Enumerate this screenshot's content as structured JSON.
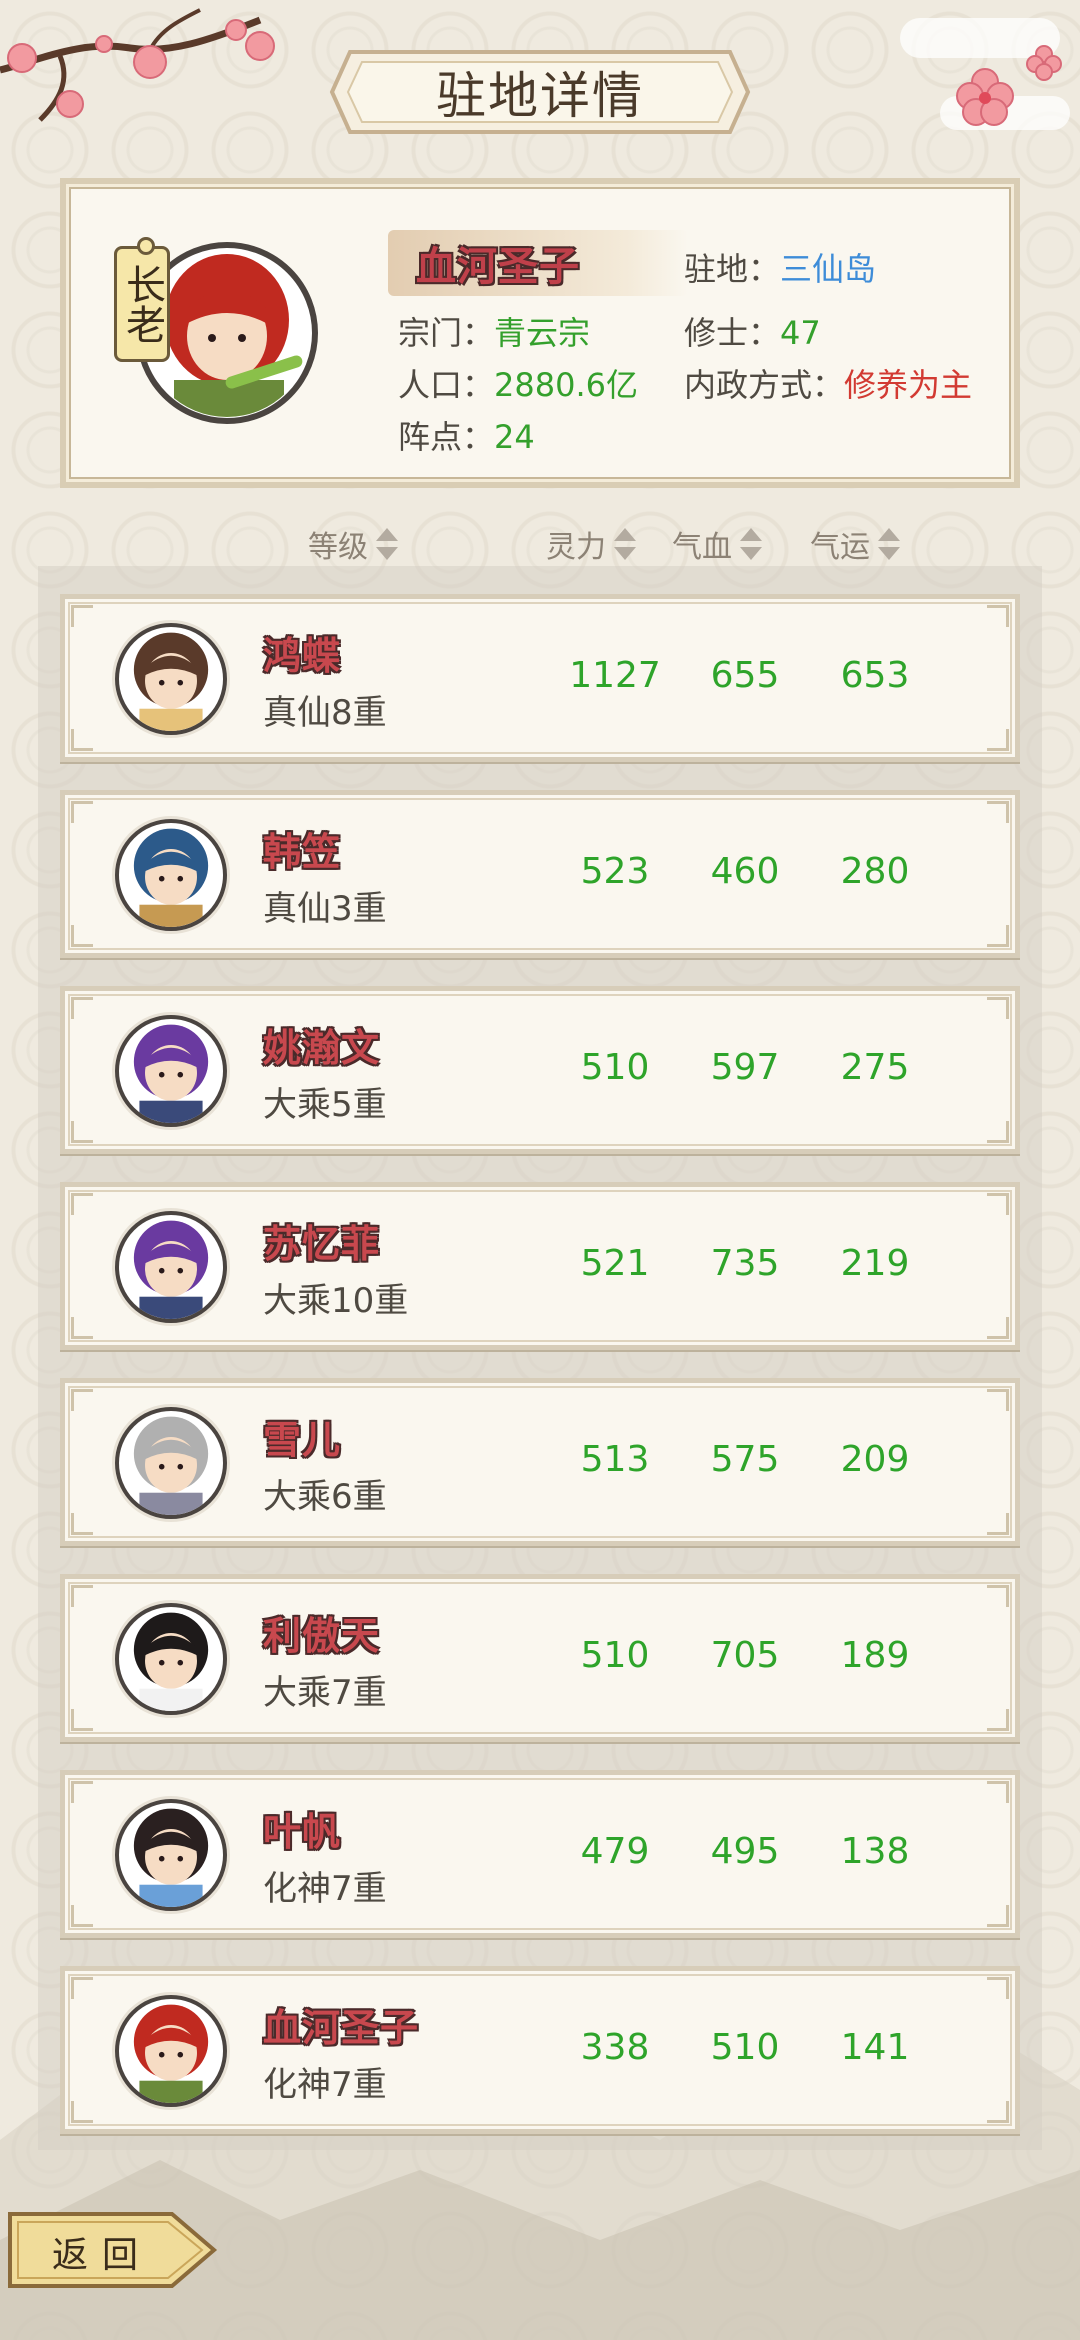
{
  "title": "驻地详情",
  "station": {
    "elder_tag": "长老",
    "name": "血河圣子",
    "location_label": "驻地：",
    "location_value": "三仙岛",
    "sect_label": "宗门：",
    "sect_value": "青云宗",
    "cultivators_label": "修士：",
    "cultivators_value": "47",
    "population_label": "人口：",
    "population_value": "2880.6亿",
    "policy_label": "内政方式：",
    "policy_value": "修养为主",
    "formation_label": "阵点：",
    "formation_value": "24"
  },
  "columns": {
    "rank": "等级",
    "spirit": "灵力",
    "blood": "气血",
    "luck": "气运"
  },
  "disciples": [
    {
      "name": "鸿蝶",
      "rank": "真仙8重",
      "spirit": "1127",
      "blood": "655",
      "luck": "653",
      "hair": "#5a3a2a",
      "robe": "#e6c27a"
    },
    {
      "name": "韩笠",
      "rank": "真仙3重",
      "spirit": "523",
      "blood": "460",
      "luck": "280",
      "hair": "#2c5a8a",
      "robe": "#c69a52"
    },
    {
      "name": "姚瀚文",
      "rank": "大乘5重",
      "spirit": "510",
      "blood": "597",
      "luck": "275",
      "hair": "#6a3aa0",
      "robe": "#3a4a7a"
    },
    {
      "name": "苏忆菲",
      "rank": "大乘10重",
      "spirit": "521",
      "blood": "735",
      "luck": "219",
      "hair": "#6a3aa0",
      "robe": "#3a4a7a"
    },
    {
      "name": "雪儿",
      "rank": "大乘6重",
      "spirit": "513",
      "blood": "575",
      "luck": "209",
      "hair": "#b0b0b0",
      "robe": "#8a8aa0"
    },
    {
      "name": "利傲天",
      "rank": "大乘7重",
      "spirit": "510",
      "blood": "705",
      "luck": "189",
      "hair": "#1e1a1a",
      "robe": "#f2f2f2"
    },
    {
      "name": "叶帆",
      "rank": "化神7重",
      "spirit": "479",
      "blood": "495",
      "luck": "138",
      "hair": "#2a2020",
      "robe": "#6aa0d8"
    },
    {
      "name": "血河圣子",
      "rank": "化神7重",
      "spirit": "338",
      "blood": "510",
      "luck": "141",
      "hair": "#c02a20",
      "robe": "#6a8a3a"
    }
  ],
  "back_button": "返回",
  "colors": {
    "name_red": "#c8484e",
    "stat_green": "#2ea42a",
    "location_blue": "#3d8cd8",
    "policy_red": "#d23a32"
  }
}
